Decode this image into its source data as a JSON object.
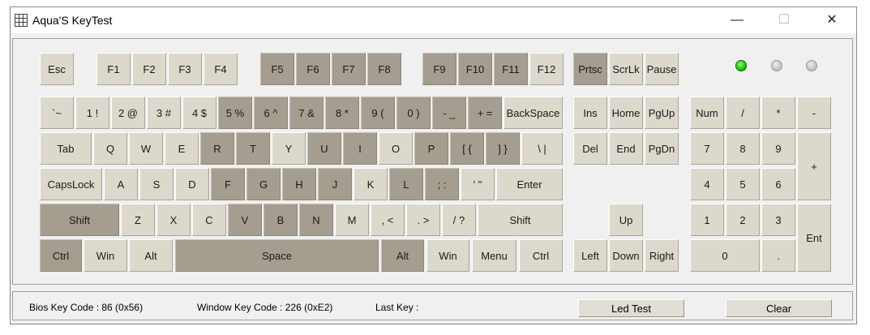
{
  "window": {
    "title": "Aqua'S KeyTest",
    "minimize_glyph": "—",
    "maximize_glyph": "☐",
    "close_glyph": "✕",
    "app_icon": "grid-icon"
  },
  "leds": [
    {
      "name": "led-1",
      "state": "on"
    },
    {
      "name": "led-2",
      "state": "off"
    },
    {
      "name": "led-3",
      "state": "off"
    }
  ],
  "colors": {
    "key_normal": "#dcd8cc",
    "key_pressed": "#a59d8f",
    "led_on": "#16b800",
    "led_off": "#bdbdbd"
  },
  "keys": [
    {
      "id": "esc",
      "label": "Esc",
      "pressed": false
    },
    {
      "id": "f1",
      "label": "F1",
      "pressed": false
    },
    {
      "id": "f2",
      "label": "F2",
      "pressed": false
    },
    {
      "id": "f3",
      "label": "F3",
      "pressed": false
    },
    {
      "id": "f4",
      "label": "F4",
      "pressed": false
    },
    {
      "id": "f5",
      "label": "F5",
      "pressed": true
    },
    {
      "id": "f6",
      "label": "F6",
      "pressed": true
    },
    {
      "id": "f7",
      "label": "F7",
      "pressed": true
    },
    {
      "id": "f8",
      "label": "F8",
      "pressed": true
    },
    {
      "id": "f9",
      "label": "F9",
      "pressed": true
    },
    {
      "id": "f10",
      "label": "F10",
      "pressed": true
    },
    {
      "id": "f11",
      "label": "F11",
      "pressed": true
    },
    {
      "id": "f12",
      "label": "F12",
      "pressed": false
    },
    {
      "id": "prtsc",
      "label": "Prtsc",
      "pressed": true
    },
    {
      "id": "scrlk",
      "label": "ScrLk",
      "pressed": false
    },
    {
      "id": "pause",
      "label": "Pause",
      "pressed": false
    },
    {
      "id": "backtick",
      "label": "`~",
      "pressed": false
    },
    {
      "id": "1",
      "label": "1 !",
      "pressed": false
    },
    {
      "id": "2",
      "label": "2 @",
      "pressed": false
    },
    {
      "id": "3",
      "label": "3 #",
      "pressed": false
    },
    {
      "id": "4",
      "label": "4 $",
      "pressed": false
    },
    {
      "id": "5",
      "label": "5 %",
      "pressed": true
    },
    {
      "id": "6",
      "label": "6 ^",
      "pressed": true
    },
    {
      "id": "7",
      "label": "7 &",
      "pressed": true
    },
    {
      "id": "8",
      "label": "8 *",
      "pressed": true
    },
    {
      "id": "9",
      "label": "9 (",
      "pressed": true
    },
    {
      "id": "0",
      "label": "0 )",
      "pressed": true
    },
    {
      "id": "minus",
      "label": "- _",
      "pressed": true
    },
    {
      "id": "equal",
      "label": "+ =",
      "pressed": true
    },
    {
      "id": "backspace",
      "label": "BackSpace",
      "pressed": false
    },
    {
      "id": "ins",
      "label": "Ins",
      "pressed": false
    },
    {
      "id": "home",
      "label": "Home",
      "pressed": false
    },
    {
      "id": "pgup",
      "label": "PgUp",
      "pressed": false
    },
    {
      "id": "num",
      "label": "Num",
      "pressed": false
    },
    {
      "id": "np-slash",
      "label": "/",
      "pressed": false
    },
    {
      "id": "np-star",
      "label": "*",
      "pressed": false
    },
    {
      "id": "np-minus",
      "label": "-",
      "pressed": false
    },
    {
      "id": "tab",
      "label": "Tab",
      "pressed": false
    },
    {
      "id": "q",
      "label": "Q",
      "pressed": false
    },
    {
      "id": "w",
      "label": "W",
      "pressed": false
    },
    {
      "id": "e",
      "label": "E",
      "pressed": false
    },
    {
      "id": "r",
      "label": "R",
      "pressed": true
    },
    {
      "id": "t",
      "label": "T",
      "pressed": true
    },
    {
      "id": "y",
      "label": "Y",
      "pressed": false
    },
    {
      "id": "u",
      "label": "U",
      "pressed": true
    },
    {
      "id": "i",
      "label": "I",
      "pressed": true
    },
    {
      "id": "o",
      "label": "O",
      "pressed": false
    },
    {
      "id": "p",
      "label": "P",
      "pressed": true
    },
    {
      "id": "lbracket",
      "label": "[ {",
      "pressed": true
    },
    {
      "id": "rbracket",
      "label": "] }",
      "pressed": true
    },
    {
      "id": "backslash",
      "label": "\\ |",
      "pressed": false
    },
    {
      "id": "del",
      "label": "Del",
      "pressed": false
    },
    {
      "id": "end",
      "label": "End",
      "pressed": false
    },
    {
      "id": "pgdn",
      "label": "PgDn",
      "pressed": false
    },
    {
      "id": "np7",
      "label": "7",
      "pressed": false
    },
    {
      "id": "np8",
      "label": "8",
      "pressed": false
    },
    {
      "id": "np9",
      "label": "9",
      "pressed": false
    },
    {
      "id": "np-plus",
      "label": "+",
      "pressed": false
    },
    {
      "id": "capslock",
      "label": "CapsLock",
      "pressed": false
    },
    {
      "id": "a",
      "label": "A",
      "pressed": false
    },
    {
      "id": "s",
      "label": "S",
      "pressed": false
    },
    {
      "id": "d",
      "label": "D",
      "pressed": false
    },
    {
      "id": "f",
      "label": "F",
      "pressed": true
    },
    {
      "id": "g",
      "label": "G",
      "pressed": true
    },
    {
      "id": "h",
      "label": "H",
      "pressed": true
    },
    {
      "id": "j",
      "label": "J",
      "pressed": true
    },
    {
      "id": "k",
      "label": "K",
      "pressed": false
    },
    {
      "id": "l",
      "label": "L",
      "pressed": true
    },
    {
      "id": "semicolon",
      "label": "; :",
      "pressed": true
    },
    {
      "id": "quote",
      "label": "' \"",
      "pressed": false
    },
    {
      "id": "enter",
      "label": "Enter",
      "pressed": false
    },
    {
      "id": "np4",
      "label": "4",
      "pressed": false
    },
    {
      "id": "np5",
      "label": "5",
      "pressed": false
    },
    {
      "id": "np6",
      "label": "6",
      "pressed": false
    },
    {
      "id": "lshift",
      "label": "Shift",
      "pressed": true
    },
    {
      "id": "z",
      "label": "Z",
      "pressed": false
    },
    {
      "id": "x",
      "label": "X",
      "pressed": false
    },
    {
      "id": "c",
      "label": "C",
      "pressed": false
    },
    {
      "id": "v",
      "label": "V",
      "pressed": true
    },
    {
      "id": "b",
      "label": "B",
      "pressed": true
    },
    {
      "id": "n",
      "label": "N",
      "pressed": true
    },
    {
      "id": "m",
      "label": "M",
      "pressed": false
    },
    {
      "id": "comma",
      "label": ", <",
      "pressed": false
    },
    {
      "id": "period",
      "label": ". >",
      "pressed": false
    },
    {
      "id": "slash",
      "label": "/ ?",
      "pressed": false
    },
    {
      "id": "rshift",
      "label": "Shift",
      "pressed": false
    },
    {
      "id": "up",
      "label": "Up",
      "pressed": false
    },
    {
      "id": "np1",
      "label": "1",
      "pressed": false
    },
    {
      "id": "np2",
      "label": "2",
      "pressed": false
    },
    {
      "id": "np3",
      "label": "3",
      "pressed": false
    },
    {
      "id": "np-enter",
      "label": "Ent",
      "pressed": false
    },
    {
      "id": "lctrl",
      "label": "Ctrl",
      "pressed": true
    },
    {
      "id": "lwin",
      "label": "Win",
      "pressed": false
    },
    {
      "id": "lalt",
      "label": "Alt",
      "pressed": false
    },
    {
      "id": "space",
      "label": "Space",
      "pressed": true
    },
    {
      "id": "ralt",
      "label": "Alt",
      "pressed": true
    },
    {
      "id": "rwin",
      "label": "Win",
      "pressed": false
    },
    {
      "id": "menu",
      "label": "Menu",
      "pressed": false
    },
    {
      "id": "rctrl",
      "label": "Ctrl",
      "pressed": false
    },
    {
      "id": "left",
      "label": "Left",
      "pressed": false
    },
    {
      "id": "down",
      "label": "Down",
      "pressed": false
    },
    {
      "id": "right",
      "label": "Right",
      "pressed": false
    },
    {
      "id": "np0",
      "label": "0",
      "pressed": false
    },
    {
      "id": "np-dot",
      "label": ".",
      "pressed": false
    }
  ],
  "status": {
    "bios_key_code": "Bios Key Code : 86 (0x56)",
    "window_key_code": "Window Key Code : 226 (0xE2)",
    "last_key": "Last Key :",
    "led_test_label": "Led Test",
    "clear_label": "Clear"
  }
}
